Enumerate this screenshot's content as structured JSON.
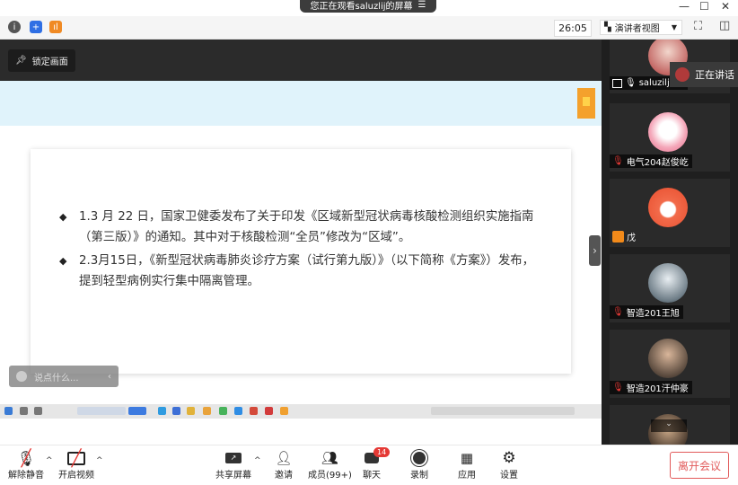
{
  "banner": {
    "text": "您正在观看saluzlij的屏幕"
  },
  "toolbar": {
    "timer": "26:05",
    "view_label": "演讲者视图"
  },
  "share": {
    "lock_label": "锁定画面",
    "bullets": [
      "1.3 月 22 日，国家卫健委发布了关于印发《区域新型冠状病毒核酸检测组织实施指南（第三版）》的通知。其中对于核酸检测“全员”修改为“区域”。",
      "2.3月15日，《新型冠状病毒肺炎诊疗方案（试行第九版）》（以下简称《方案》）发布，提到轻型病例实行集中隔离管理。"
    ],
    "chat_placeholder": "说点什么..."
  },
  "gallery": {
    "speaking_label": "正在讲话",
    "participants": [
      {
        "name": "saluziljEm"
      },
      {
        "name": "电气204赵俊屹"
      },
      {
        "name": "戊"
      },
      {
        "name": "智造201王旭"
      },
      {
        "name": "智造201汗仲豪"
      }
    ]
  },
  "bottom": {
    "unmute": "解除静音",
    "video": "开启视频",
    "share": "共享屏幕",
    "invite": "邀请",
    "members": "成员(99+)",
    "chat": "聊天",
    "chat_badge": "14",
    "record": "录制",
    "apps": "应用",
    "settings": "设置",
    "leave": "离开会议"
  },
  "colors": {
    "accent": "#e25a5a",
    "band": "#e0f3fb",
    "tag": "#f4a12c"
  }
}
